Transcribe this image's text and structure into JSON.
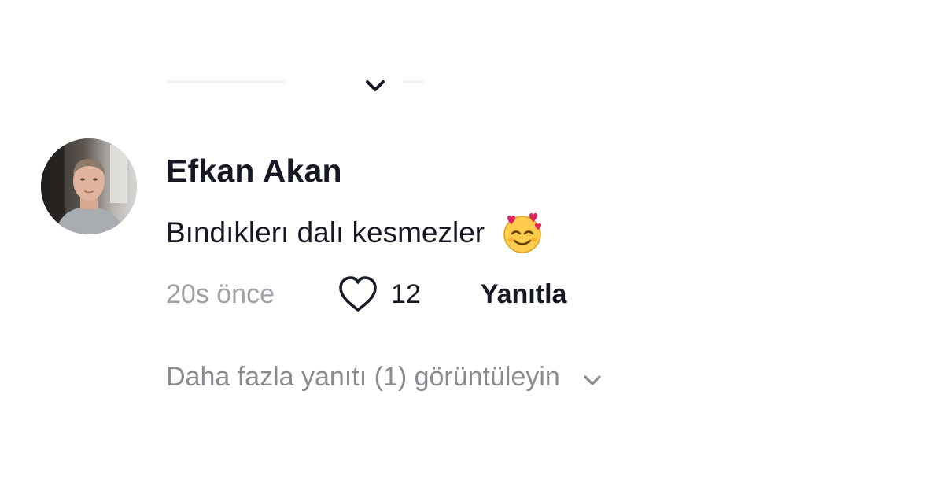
{
  "comment": {
    "username": "Efkan Akan",
    "text": "Bındıklerı dalı kesmezler",
    "emoji": "smiling-face-with-hearts",
    "timestamp": "20s önce",
    "likes": "12",
    "reply_label": "Yanıtla"
  },
  "replies": {
    "more_label": "Daha fazla yanıtı (1) görüntüleyin"
  },
  "icons": {
    "top": "chevron-down-icon",
    "like": "heart-icon",
    "expand": "chevron-down-icon"
  },
  "colors": {
    "primary_text": "#161823",
    "secondary_text": "#a1a2a7",
    "muted_link": "#8a8b91",
    "background": "#ffffff"
  }
}
